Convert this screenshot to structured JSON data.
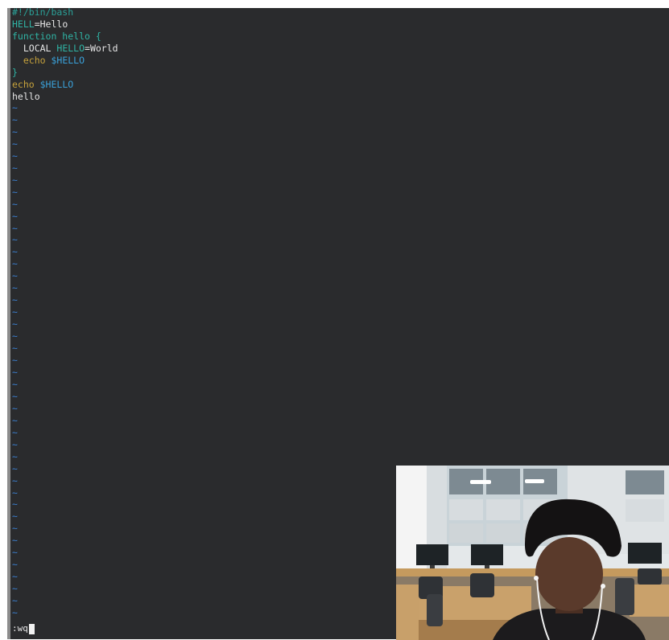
{
  "editor": {
    "lines": [
      {
        "parts": [
          {
            "t": "#!/bin/bash",
            "c": "c-comment"
          }
        ]
      },
      {
        "parts": [
          {
            "t": "HELL",
            "c": "c-var"
          },
          {
            "t": "=Hello",
            "c": "c-plain"
          }
        ]
      },
      {
        "parts": [
          {
            "t": "function hello {",
            "c": "c-kw"
          }
        ]
      },
      {
        "parts": [
          {
            "t": "  LOCAL ",
            "c": "c-plain"
          },
          {
            "t": "HELLO",
            "c": "c-var"
          },
          {
            "t": "=World",
            "c": "c-plain"
          }
        ]
      },
      {
        "parts": [
          {
            "t": "  echo ",
            "c": "c-echo"
          },
          {
            "t": "$HELLO",
            "c": "c-dollar"
          }
        ]
      },
      {
        "parts": [
          {
            "t": "}",
            "c": "c-brace"
          }
        ]
      },
      {
        "parts": [
          {
            "t": "echo ",
            "c": "c-echo"
          },
          {
            "t": "$HELLO",
            "c": "c-dollar"
          }
        ]
      },
      {
        "parts": [
          {
            "t": "hello",
            "c": "c-plain"
          }
        ]
      }
    ],
    "empty_line_marker": "~",
    "empty_line_count": 43
  },
  "command_line": {
    "text": ":wq"
  },
  "colors": {
    "background": "#2a2b2d",
    "comment": "#2aa198",
    "keyword": "#2fb3a4",
    "echo": "#c6a23c",
    "dollar_var": "#3aa0d8",
    "tilde": "#3a7fd0"
  },
  "webcam": {
    "description_icon": "webcam-feed-icon"
  }
}
